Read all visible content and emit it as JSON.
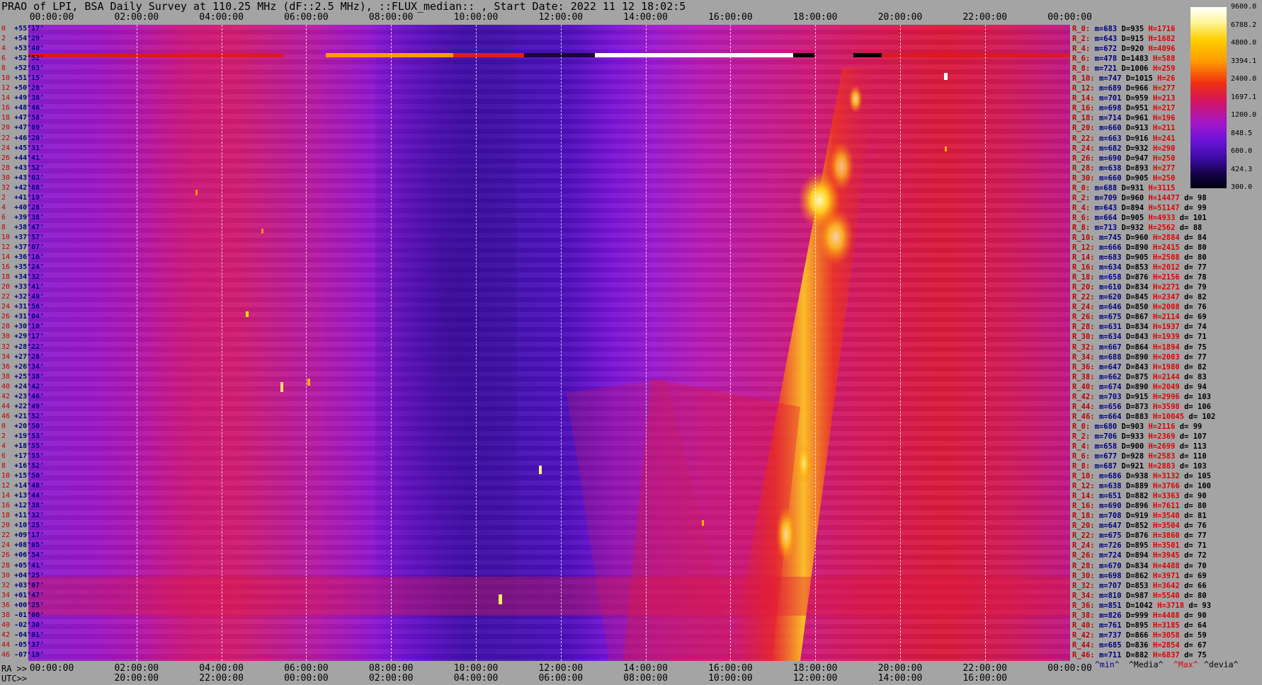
{
  "header": {
    "title": "PRAO of LPI, BSA Daily Survey at 110.25 MHz (dF::2.5 MHz), ::FLUX_median:: , Start Date: 2022 11 12 18:02:5"
  },
  "top_axis": [
    "00:00:00",
    "02:00:00",
    "04:00:00",
    "06:00:00",
    "08:00:00",
    "10:00:00",
    "12:00:00",
    "14:00:00",
    "16:00:00",
    "18:00:00",
    "20:00:00",
    "22:00:00",
    "00:00:00"
  ],
  "bottom_axis_ra": {
    "label": "RA >>",
    "ticks": [
      "00:00:00",
      "02:00:00",
      "04:00:00",
      "06:00:00",
      "08:00:00",
      "10:00:00",
      "12:00:00",
      "14:00:00",
      "16:00:00",
      "18:00:00",
      "20:00:00",
      "22:00:00",
      "00:00:00"
    ]
  },
  "bottom_axis_utc": {
    "label": "UTC>>",
    "ticks": [
      "20:00:00",
      "22:00:00",
      "00:00:00",
      "02:00:00",
      "04:00:00",
      "06:00:00",
      "08:00:00",
      "10:00:00",
      "12:00:00",
      "14:00:00",
      "16:00:00"
    ]
  },
  "declinations": [
    {
      "idx": "0",
      "val": "+55°17'"
    },
    {
      "idx": "2",
      "val": "+54°29'"
    },
    {
      "idx": "4",
      "val": "+53°40'"
    },
    {
      "idx": "6",
      "val": "+52°52'"
    },
    {
      "idx": "8",
      "val": "+52°03'"
    },
    {
      "idx": "10",
      "val": "+51°15'"
    },
    {
      "idx": "12",
      "val": "+50°26'"
    },
    {
      "idx": "14",
      "val": "+49°38'"
    },
    {
      "idx": "16",
      "val": "+48°46'"
    },
    {
      "idx": "18",
      "val": "+47°58'"
    },
    {
      "idx": "20",
      "val": "+47°09'"
    },
    {
      "idx": "22",
      "val": "+46°20'"
    },
    {
      "idx": "24",
      "val": "+45°31'"
    },
    {
      "idx": "26",
      "val": "+44°41'"
    },
    {
      "idx": "28",
      "val": "+43°52'"
    },
    {
      "idx": "30",
      "val": "+43°03'"
    },
    {
      "idx": "32",
      "val": "+42°08'"
    },
    {
      "idx": "2",
      "val": "+41°19'"
    },
    {
      "idx": "4",
      "val": "+40°28'"
    },
    {
      "idx": "6",
      "val": "+39°38'"
    },
    {
      "idx": "8",
      "val": "+38°47'"
    },
    {
      "idx": "10",
      "val": "+37°57'"
    },
    {
      "idx": "12",
      "val": "+37°07'"
    },
    {
      "idx": "14",
      "val": "+36°16'"
    },
    {
      "idx": "16",
      "val": "+35°24'"
    },
    {
      "idx": "18",
      "val": "+34°32'"
    },
    {
      "idx": "20",
      "val": "+33°41'"
    },
    {
      "idx": "22",
      "val": "+32°49'"
    },
    {
      "idx": "24",
      "val": "+31°56'"
    },
    {
      "idx": "26",
      "val": "+31°04'"
    },
    {
      "idx": "28",
      "val": "+30°10'"
    },
    {
      "idx": "30",
      "val": "+29°17'"
    },
    {
      "idx": "32",
      "val": "+28°22'"
    },
    {
      "idx": "34",
      "val": "+27°28'"
    },
    {
      "idx": "36",
      "val": "+26°34'"
    },
    {
      "idx": "38",
      "val": "+25°38'"
    },
    {
      "idx": "40",
      "val": "+24°42'"
    },
    {
      "idx": "42",
      "val": "+23°46'"
    },
    {
      "idx": "44",
      "val": "+22°49'"
    },
    {
      "idx": "46",
      "val": "+21°52'"
    },
    {
      "idx": "0",
      "val": "+20°50'"
    },
    {
      "idx": "2",
      "val": "+19°53'"
    },
    {
      "idx": "4",
      "val": "+18°55'"
    },
    {
      "idx": "6",
      "val": "+17°55'"
    },
    {
      "idx": "8",
      "val": "+16°52'"
    },
    {
      "idx": "10",
      "val": "+15°50'"
    },
    {
      "idx": "12",
      "val": "+14°48'"
    },
    {
      "idx": "14",
      "val": "+13°44'"
    },
    {
      "idx": "16",
      "val": "+12°38'"
    },
    {
      "idx": "18",
      "val": "+11°32'"
    },
    {
      "idx": "20",
      "val": "+10°25'"
    },
    {
      "idx": "22",
      "val": "+09°17'"
    },
    {
      "idx": "24",
      "val": "+08°05'"
    },
    {
      "idx": "26",
      "val": "+06°54'"
    },
    {
      "idx": "28",
      "val": "+05°41'"
    },
    {
      "idx": "30",
      "val": "+04°25'"
    },
    {
      "idx": "32",
      "val": "+03°07'"
    },
    {
      "idx": "34",
      "val": "+01°47'"
    },
    {
      "idx": "36",
      "val": "+00°25'"
    },
    {
      "idx": "38",
      "val": "-01°00'"
    },
    {
      "idx": "40",
      "val": "-02°30'"
    },
    {
      "idx": "42",
      "val": "-04°01'"
    },
    {
      "idx": "44",
      "val": "-05°37'"
    },
    {
      "idx": "46",
      "val": "-07°19'"
    }
  ],
  "stats": [
    {
      "r": "R_0:",
      "m": "m=683",
      "d": "D=935",
      "h": "H=1716",
      "dv": ""
    },
    {
      "r": "R_2:",
      "m": "m=643",
      "d": "D=915",
      "h": "H=1682",
      "dv": ""
    },
    {
      "r": "R_4:",
      "m": "m=672",
      "d": "D=920",
      "h": "H=4096",
      "dv": ""
    },
    {
      "r": "R_6:",
      "m": "m=478",
      "d": "D=1483",
      "h": "H=588",
      "dv": ""
    },
    {
      "r": "R_8:",
      "m": "m=721",
      "d": "D=1006",
      "h": "H=259",
      "dv": ""
    },
    {
      "r": "R_10:",
      "m": "m=747",
      "d": "D=1015",
      "h": "H=26",
      "dv": ""
    },
    {
      "r": "R_12:",
      "m": "m=689",
      "d": "D=966",
      "h": "H=277",
      "dv": ""
    },
    {
      "r": "R_14:",
      "m": "m=701",
      "d": "D=959",
      "h": "H=213",
      "dv": ""
    },
    {
      "r": "R_16:",
      "m": "m=698",
      "d": "D=951",
      "h": "H=217",
      "dv": ""
    },
    {
      "r": "R_18:",
      "m": "m=714",
      "d": "D=961",
      "h": "H=196",
      "dv": ""
    },
    {
      "r": "R_20:",
      "m": "m=660",
      "d": "D=913",
      "h": "H=211",
      "dv": ""
    },
    {
      "r": "R_22:",
      "m": "m=663",
      "d": "D=916",
      "h": "H=241",
      "dv": ""
    },
    {
      "r": "R_24:",
      "m": "m=682",
      "d": "D=932",
      "h": "H=290",
      "dv": ""
    },
    {
      "r": "R_26:",
      "m": "m=690",
      "d": "D=947",
      "h": "H=250",
      "dv": ""
    },
    {
      "r": "R_28:",
      "m": "m=638",
      "d": "D=893",
      "h": "H=277",
      "dv": ""
    },
    {
      "r": "R_30:",
      "m": "m=660",
      "d": "D=905",
      "h": "H=250",
      "dv": ""
    },
    {
      "r": "R_0:",
      "m": "m=688",
      "d": "D=931",
      "h": "H=3115",
      "dv": ""
    },
    {
      "r": "R_2:",
      "m": "m=709",
      "d": "D=960",
      "h": "H=14477",
      "dv": "d= 98"
    },
    {
      "r": "R_4:",
      "m": "m=643",
      "d": "D=894",
      "h": "H=51147",
      "dv": "d= 99"
    },
    {
      "r": "R_6:",
      "m": "m=664",
      "d": "D=905",
      "h": "H=4933",
      "dv": "d= 101"
    },
    {
      "r": "R_8:",
      "m": "m=713",
      "d": "D=932",
      "h": "H=2562",
      "dv": "d= 88"
    },
    {
      "r": "R_10:",
      "m": "m=745",
      "d": "D=960",
      "h": "H=2884",
      "dv": "d= 84"
    },
    {
      "r": "R_12:",
      "m": "m=666",
      "d": "D=890",
      "h": "H=2415",
      "dv": "d= 80"
    },
    {
      "r": "R_14:",
      "m": "m=683",
      "d": "D=905",
      "h": "H=2508",
      "dv": "d= 80"
    },
    {
      "r": "R_16:",
      "m": "m=634",
      "d": "D=853",
      "h": "H=2012",
      "dv": "d= 77"
    },
    {
      "r": "R_18:",
      "m": "m=658",
      "d": "D=876",
      "h": "H=2156",
      "dv": "d= 78"
    },
    {
      "r": "R_20:",
      "m": "m=610",
      "d": "D=834",
      "h": "H=2271",
      "dv": "d= 79"
    },
    {
      "r": "R_22:",
      "m": "m=620",
      "d": "D=845",
      "h": "H=2347",
      "dv": "d= 82"
    },
    {
      "r": "R_24:",
      "m": "m=646",
      "d": "D=850",
      "h": "H=2008",
      "dv": "d= 76"
    },
    {
      "r": "R_26:",
      "m": "m=675",
      "d": "D=867",
      "h": "H=2114",
      "dv": "d= 69"
    },
    {
      "r": "R_28:",
      "m": "m=631",
      "d": "D=834",
      "h": "H=1937",
      "dv": "d= 74"
    },
    {
      "r": "R_30:",
      "m": "m=634",
      "d": "D=843",
      "h": "H=1939",
      "dv": "d= 71"
    },
    {
      "r": "R_32:",
      "m": "m=667",
      "d": "D=864",
      "h": "H=1894",
      "dv": "d= 75"
    },
    {
      "r": "R_34:",
      "m": "m=688",
      "d": "D=890",
      "h": "H=2003",
      "dv": "d= 77"
    },
    {
      "r": "R_36:",
      "m": "m=647",
      "d": "D=843",
      "h": "H=1980",
      "dv": "d= 82"
    },
    {
      "r": "R_38:",
      "m": "m=662",
      "d": "D=875",
      "h": "H=2144",
      "dv": "d= 83"
    },
    {
      "r": "R_40:",
      "m": "m=674",
      "d": "D=890",
      "h": "H=2049",
      "dv": "d= 94"
    },
    {
      "r": "R_42:",
      "m": "m=703",
      "d": "D=915",
      "h": "H=2996",
      "dv": "d= 103"
    },
    {
      "r": "R_44:",
      "m": "m=656",
      "d": "D=873",
      "h": "H=3598",
      "dv": "d= 106"
    },
    {
      "r": "R_46:",
      "m": "m=664",
      "d": "D=883",
      "h": "H=10045",
      "dv": "d= 102"
    },
    {
      "r": "R_0:",
      "m": "m=680",
      "d": "D=903",
      "h": "H=2116",
      "dv": "d= 99"
    },
    {
      "r": "R_2:",
      "m": "m=706",
      "d": "D=933",
      "h": "H=2369",
      "dv": "d= 107"
    },
    {
      "r": "R_4:",
      "m": "m=658",
      "d": "D=900",
      "h": "H=2699",
      "dv": "d= 113"
    },
    {
      "r": "R_6:",
      "m": "m=677",
      "d": "D=928",
      "h": "H=2583",
      "dv": "d= 110"
    },
    {
      "r": "R_8:",
      "m": "m=687",
      "d": "D=921",
      "h": "H=2883",
      "dv": "d= 103"
    },
    {
      "r": "R_10:",
      "m": "m=686",
      "d": "D=938",
      "h": "H=3132",
      "dv": "d= 105"
    },
    {
      "r": "R_12:",
      "m": "m=638",
      "d": "D=889",
      "h": "H=3766",
      "dv": "d= 100"
    },
    {
      "r": "R_14:",
      "m": "m=651",
      "d": "D=882",
      "h": "H=3363",
      "dv": "d= 90"
    },
    {
      "r": "R_16:",
      "m": "m=690",
      "d": "D=896",
      "h": "H=7611",
      "dv": "d= 80"
    },
    {
      "r": "R_18:",
      "m": "m=708",
      "d": "D=919",
      "h": "H=3540",
      "dv": "d= 81"
    },
    {
      "r": "R_20:",
      "m": "m=647",
      "d": "D=852",
      "h": "H=3504",
      "dv": "d= 76"
    },
    {
      "r": "R_22:",
      "m": "m=675",
      "d": "D=876",
      "h": "H=3860",
      "dv": "d= 77"
    },
    {
      "r": "R_24:",
      "m": "m=726",
      "d": "D=895",
      "h": "H=3501",
      "dv": "d= 71"
    },
    {
      "r": "R_26:",
      "m": "m=724",
      "d": "D=894",
      "h": "H=3945",
      "dv": "d= 72"
    },
    {
      "r": "R_28:",
      "m": "m=670",
      "d": "D=834",
      "h": "H=4488",
      "dv": "d= 70"
    },
    {
      "r": "R_30:",
      "m": "m=698",
      "d": "D=862",
      "h": "H=3971",
      "dv": "d= 69"
    },
    {
      "r": "R_32:",
      "m": "m=707",
      "d": "D=853",
      "h": "H=3642",
      "dv": "d= 66"
    },
    {
      "r": "R_34:",
      "m": "m=810",
      "d": "D=987",
      "h": "H=5540",
      "dv": "d= 80"
    },
    {
      "r": "R_36:",
      "m": "m=851",
      "d": "D=1042",
      "h": "H=3718",
      "dv": "d= 93"
    },
    {
      "r": "R_38:",
      "m": "m=826",
      "d": "D=999",
      "h": "H=4488",
      "dv": "d= 90"
    },
    {
      "r": "R_40:",
      "m": "m=761",
      "d": "D=895",
      "h": "H=3185",
      "dv": "d= 64"
    },
    {
      "r": "R_42:",
      "m": "m=737",
      "d": "D=866",
      "h": "H=3058",
      "dv": "d= 59"
    },
    {
      "r": "R_44:",
      "m": "m=685",
      "d": "D=836",
      "h": "H=2854",
      "dv": "d= 67"
    },
    {
      "r": "R_46:",
      "m": "m=711",
      "d": "D=882",
      "h": "H=6837",
      "dv": "d= 75"
    }
  ],
  "colorbar": {
    "labels": [
      "9600.0",
      "6788.2",
      "4800.0",
      "3394.1",
      "2400.0",
      "1697.1",
      "1200.0",
      "848.5",
      "600.0",
      "424.3",
      "300.0"
    ]
  },
  "legend": {
    "min": "^min^",
    "median": "^Media^",
    "max": "^Max^",
    "dev": "^devia^"
  }
}
